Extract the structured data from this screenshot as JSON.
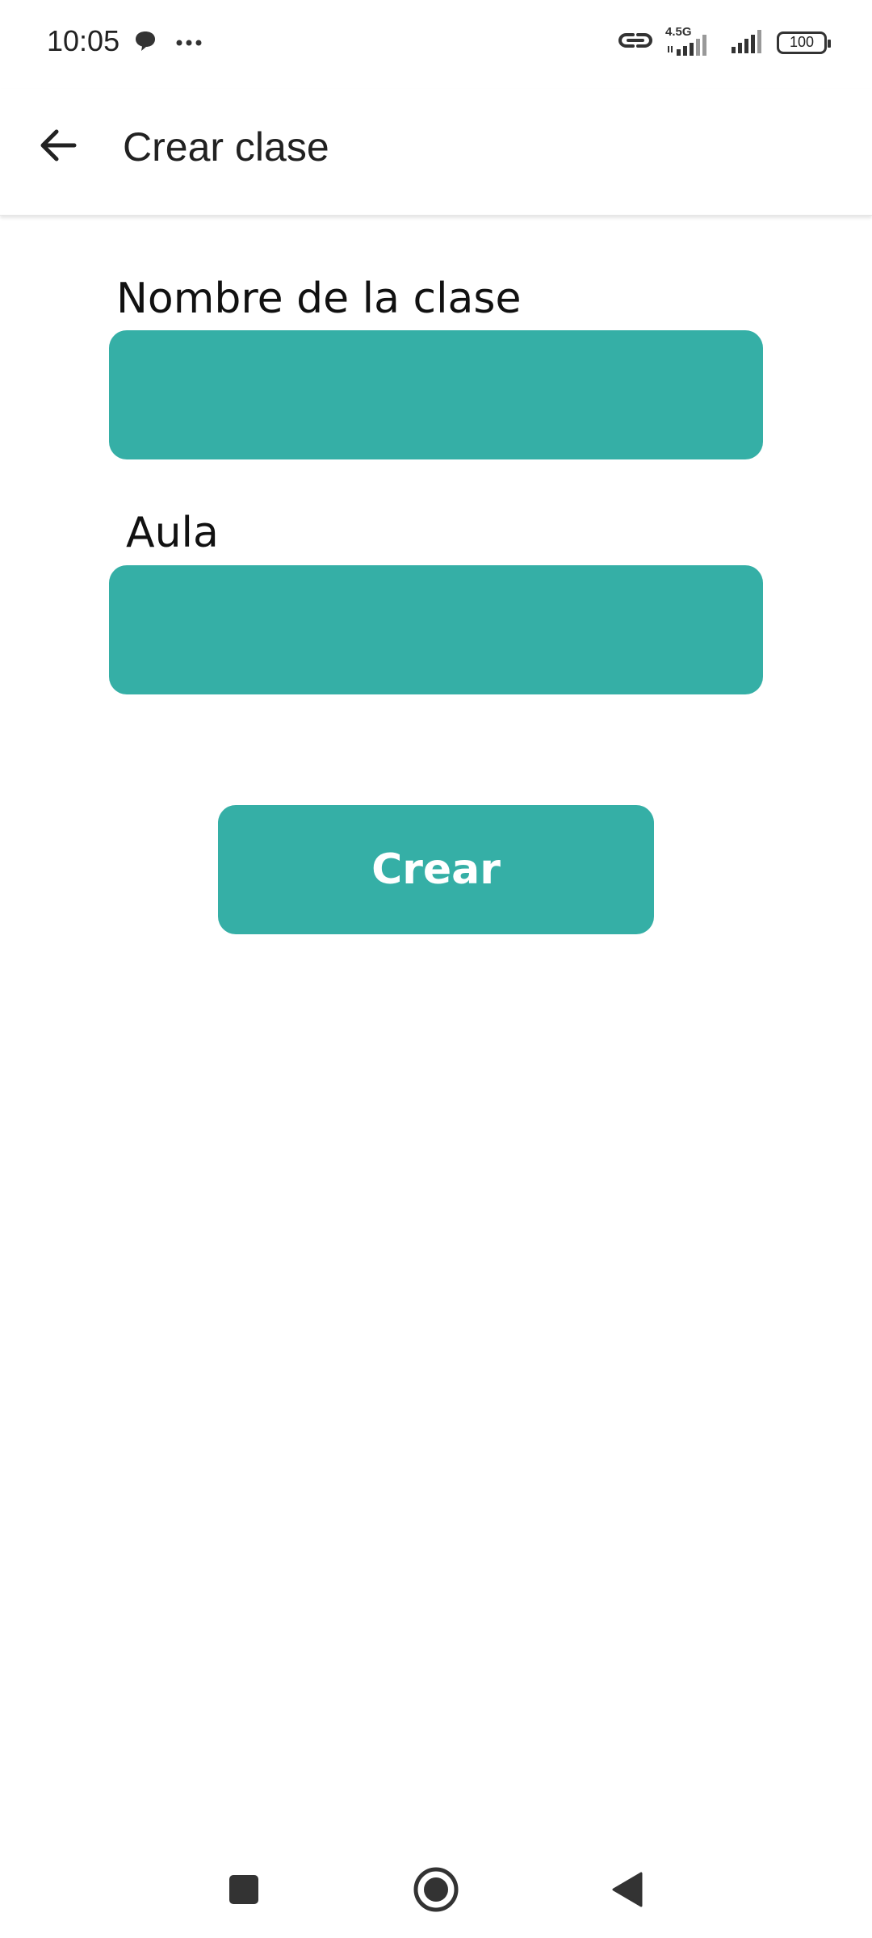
{
  "status_bar": {
    "time": "10:05",
    "network_label": "4.5G",
    "battery": "100",
    "icons": [
      "chat-bubble-icon",
      "more-dots-icon",
      "link-icon",
      "signal-icon",
      "signal-icon",
      "battery-icon"
    ]
  },
  "app_bar": {
    "title": "Crear clase",
    "back_icon": "arrow-left-icon"
  },
  "form": {
    "fields": [
      {
        "label": "Nombre de la clase",
        "value": "",
        "placeholder": ""
      },
      {
        "label": "Aula",
        "value": "",
        "placeholder": ""
      }
    ],
    "submit_label": "Crear"
  },
  "nav_bar": {
    "icons": [
      "recents-square-icon",
      "home-circle-icon",
      "back-triangle-icon"
    ]
  },
  "colors": {
    "accent": "#35afa6",
    "background": "#ffffff",
    "text": "#212121"
  }
}
